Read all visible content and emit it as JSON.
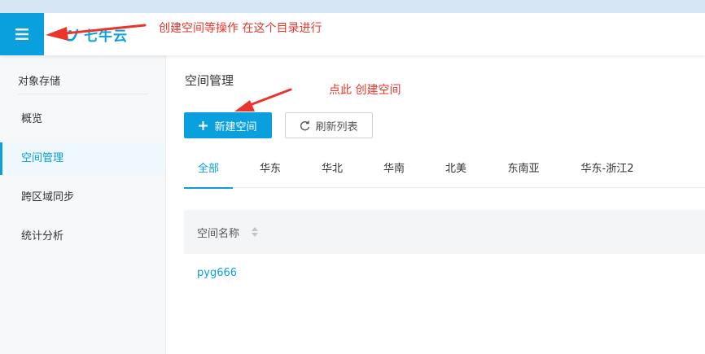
{
  "header": {
    "logo_text": "七牛云",
    "annotation": "创建空间等操作  在这个目录进行"
  },
  "sidebar": {
    "title": "对象存储",
    "items": [
      {
        "label": "概览",
        "active": false
      },
      {
        "label": "空间管理",
        "active": true
      },
      {
        "label": "跨区域同步",
        "active": false
      },
      {
        "label": "统计分析",
        "active": false
      }
    ]
  },
  "main": {
    "title": "空间管理",
    "annotation": "点此  创建空间",
    "create_button": "新建空间",
    "refresh_button": "刷新列表",
    "tabs": [
      {
        "label": "全部",
        "active": true
      },
      {
        "label": "华东",
        "active": false
      },
      {
        "label": "华北",
        "active": false
      },
      {
        "label": "华南",
        "active": false
      },
      {
        "label": "北美",
        "active": false
      },
      {
        "label": "东南亚",
        "active": false
      },
      {
        "label": "华东-浙江2",
        "active": false
      }
    ],
    "table": {
      "column_header": "空间名称",
      "rows": [
        "pyg666"
      ]
    }
  },
  "colors": {
    "accent": "#0aa0de",
    "annotation": "#e8362d"
  },
  "icons": [
    "hamburger-menu-icon",
    "logo-icon",
    "plus-icon",
    "refresh-icon",
    "sort-icon"
  ]
}
